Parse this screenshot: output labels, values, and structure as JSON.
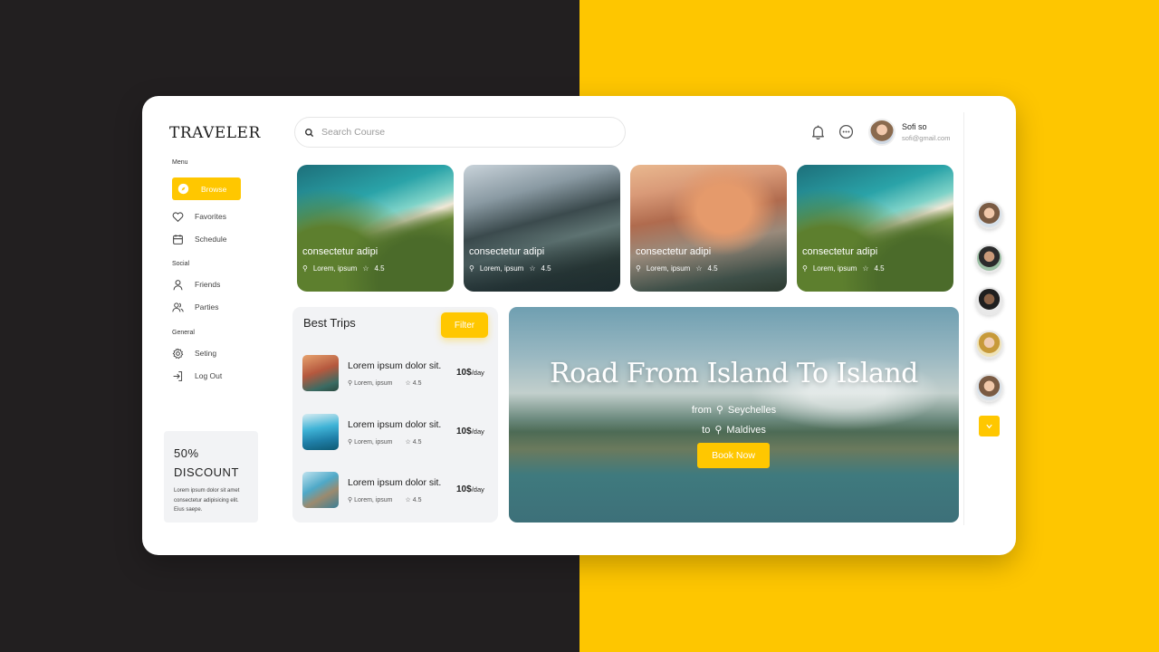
{
  "sidebar": {
    "logo": "TRAVELER",
    "menu_label": "Menu",
    "menu": [
      {
        "label": "Browse",
        "icon": "compass-icon"
      },
      {
        "label": "Favorites",
        "icon": "heart-icon"
      },
      {
        "label": "Schedule",
        "icon": "calendar-icon"
      }
    ],
    "social_label": "Social",
    "social": [
      {
        "label": "Friends",
        "icon": "user-icon"
      },
      {
        "label": "Parties",
        "icon": "users-icon"
      }
    ],
    "general_label": "General",
    "general": [
      {
        "label": "Seting",
        "icon": "gear-icon"
      },
      {
        "label": "Log Out",
        "icon": "logout-icon"
      }
    ],
    "discount": {
      "percent": "50%",
      "title": "DISCOUNT",
      "text": "Lorem ipsum dolor sit amet consectetur adipisicing elit. Eius saepe."
    }
  },
  "header": {
    "search_placeholder": "Search Course",
    "user_name": "Sofi so",
    "user_email": "sofi@gmail.com"
  },
  "destinations": [
    {
      "title": "consectetur adipi",
      "location": "Lorem, ipsum",
      "rating": "4.5"
    },
    {
      "title": "consectetur adipi",
      "location": "Lorem, ipsum",
      "rating": "4.5"
    },
    {
      "title": "consectetur adipi",
      "location": "Lorem, ipsum",
      "rating": "4.5"
    },
    {
      "title": "consectetur adipi",
      "location": "Lorem, ipsum",
      "rating": "4.5"
    }
  ],
  "best_trips": {
    "heading": "Best Trips",
    "filter_label": "Filter",
    "items": [
      {
        "name": "Lorem ipsum dolor sit.",
        "location": "Lorem, ipsum",
        "rating": "4.5",
        "price": "10$",
        "unit": "/day"
      },
      {
        "name": "Lorem ipsum dolor sit.",
        "location": "Lorem, ipsum",
        "rating": "4.5",
        "price": "10$",
        "unit": "/day"
      },
      {
        "name": "Lorem ipsum dolor sit.",
        "location": "Lorem, ipsum",
        "rating": "4.5",
        "price": "10$",
        "unit": "/day"
      }
    ]
  },
  "hero": {
    "title": "Road From Island To Island",
    "from_label": "from",
    "from_place": "Seychelles",
    "to_label": "to",
    "to_place": "Maldives",
    "button": "Book Now"
  },
  "colors": {
    "accent": "#ffc700",
    "dark_bg": "#221f20",
    "yellow_bg": "#fec600"
  }
}
